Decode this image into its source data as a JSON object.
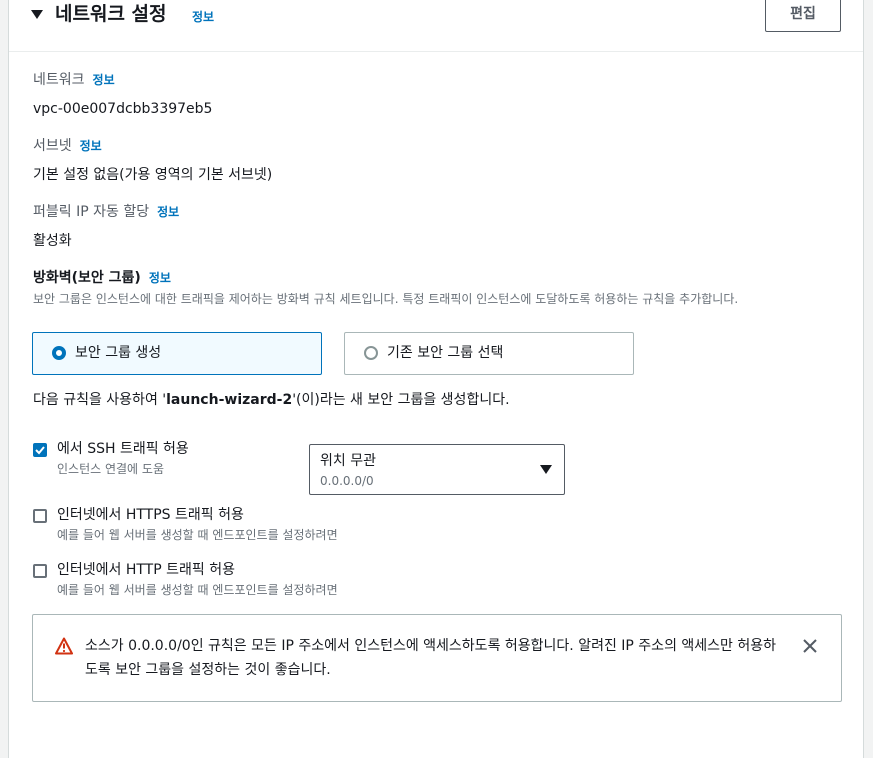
{
  "section": {
    "title": "네트워크 설정",
    "info": "정보",
    "edit_label": "편집"
  },
  "network": {
    "label": "네트워크",
    "info": "정보",
    "value": "vpc-00e007dcbb3397eb5"
  },
  "subnet": {
    "label": "서브넷",
    "info": "정보",
    "value": "기본 설정 없음(가용 영역의 기본 서브넷)"
  },
  "public_ip": {
    "label": "퍼블릭 IP 자동 할당",
    "info": "정보",
    "value": "활성화"
  },
  "firewall": {
    "label": "방화벽(보안 그룹)",
    "info": "정보",
    "description": "보안 그룹은 인스턴스에 대한 트래픽을 제어하는 방화벽 규칙 세트입니다. 특정 트래픽이 인스턴스에 도달하도록 허용하는 규칙을 추가합니다.",
    "option_create": "보안 그룹 생성",
    "option_existing": "기존 보안 그룹 선택",
    "selected": "보안 그룹 생성"
  },
  "rule_sentence": {
    "prefix": "다음 규칙을 사용하여 '",
    "name": "launch-wizard-2",
    "suffix": "'(이)라는 새 보안 그룹을 생성합니다."
  },
  "rules": [
    {
      "label": "에서 SSH 트래픽 허용",
      "sub": "인스턴스 연결에 도움",
      "checked": true
    },
    {
      "label": "인터넷에서 HTTPS 트래픽 허용",
      "sub": "예를 들어 웹 서버를 생성할 때 엔드포인트를 설정하려면",
      "checked": false
    },
    {
      "label": "인터넷에서 HTTP 트래픽 허용",
      "sub": "예를 들어 웹 서버를 생성할 때 엔드포인트를 설정하려면",
      "checked": false
    }
  ],
  "ssh_source": {
    "value": "위치 무관",
    "sub": "0.0.0.0/0"
  },
  "alert": {
    "text": "소스가 0.0.0.0/0인 규칙은 모든 IP 주소에서 인스턴스에 액세스하도록 허용합니다. 알려진 IP 주소의 액세스만 허용하도록 보안 그룹을 설정하는 것이 좋습니다."
  },
  "colors": {
    "accent": "#0073bb",
    "warning": "#d13212"
  }
}
